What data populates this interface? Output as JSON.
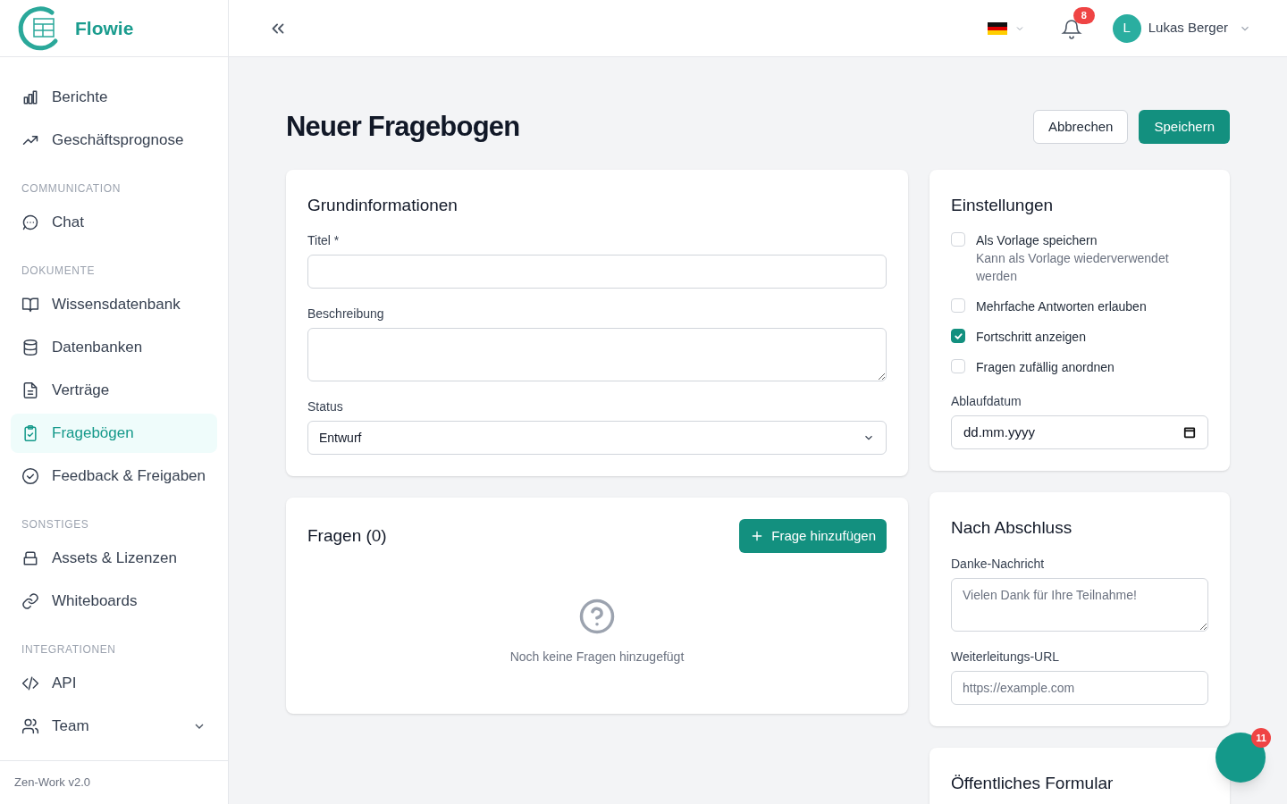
{
  "brand": {
    "name": "Flowie"
  },
  "sidebar": {
    "sections": [
      {
        "items": [
          {
            "label": "Berichte",
            "selected": false
          },
          {
            "label": "Geschäftsprognose",
            "selected": false
          }
        ]
      },
      {
        "title": "COMMUNICATION",
        "items": [
          {
            "label": "Chat",
            "selected": false
          }
        ]
      },
      {
        "title": "DOKUMENTE",
        "items": [
          {
            "label": "Wissensdatenbank",
            "selected": false
          },
          {
            "label": "Datenbanken",
            "selected": false
          },
          {
            "label": "Verträge",
            "selected": false
          },
          {
            "label": "Fragebögen",
            "selected": true
          },
          {
            "label": "Feedback & Freigaben",
            "selected": false
          }
        ]
      },
      {
        "title": "SONSTIGES",
        "items": [
          {
            "label": "Assets & Lizenzen",
            "selected": false
          },
          {
            "label": "Whiteboards",
            "selected": false
          }
        ]
      },
      {
        "title": "INTEGRATIONEN",
        "items": [
          {
            "label": "API",
            "selected": false
          },
          {
            "label": "Team",
            "selected": false,
            "expanded": false
          }
        ]
      }
    ],
    "footer": "Zen-Work v2.0"
  },
  "header": {
    "notifications": "8",
    "user": {
      "initial": "L",
      "name": "Lukas Berger"
    }
  },
  "page": {
    "title": "Neuer Fragebogen",
    "buttons": [
      {
        "label": "Abbrechen",
        "kind": "secondary"
      },
      {
        "label": "Speichern",
        "kind": "primary"
      }
    ]
  },
  "basic": {
    "title": "Grundinformationen",
    "fields": [
      {
        "kind": "input",
        "label": "Titel *"
      },
      {
        "kind": "textarea",
        "label": "Beschreibung"
      },
      {
        "kind": "select",
        "label": "Status",
        "value": "Entwurf"
      }
    ]
  },
  "questions": {
    "title": "Fragen (0)",
    "add_button": "Frage hinzufügen",
    "empty": "Noch keine Fragen hinzugefügt"
  },
  "settings": {
    "title": "Einstellungen",
    "options": [
      {
        "label": "Als Vorlage speichern",
        "description": "Kann als Vorlage wiederverwendet werden",
        "checked": false
      },
      {
        "label": "Mehrfache Antworten erlauben",
        "checked": false
      },
      {
        "label": "Fortschritt anzeigen",
        "checked": true
      },
      {
        "label": "Fragen zufällig anordnen",
        "checked": false
      }
    ],
    "date": {
      "label": "Ablaufdatum",
      "placeholder": "dd.mm.yyyy"
    }
  },
  "after": {
    "title": "Nach Abschluss",
    "fields": [
      {
        "kind": "textarea",
        "label": "Danke-Nachricht",
        "placeholder": "Vielen Dank für Ihre Teilnahme!"
      },
      {
        "kind": "input",
        "label": "Weiterleitungs-URL",
        "placeholder": "https://example.com"
      }
    ]
  },
  "public_form": {
    "title": "Öffentliches Formular"
  },
  "chat_bubble": {
    "badge": "11"
  }
}
